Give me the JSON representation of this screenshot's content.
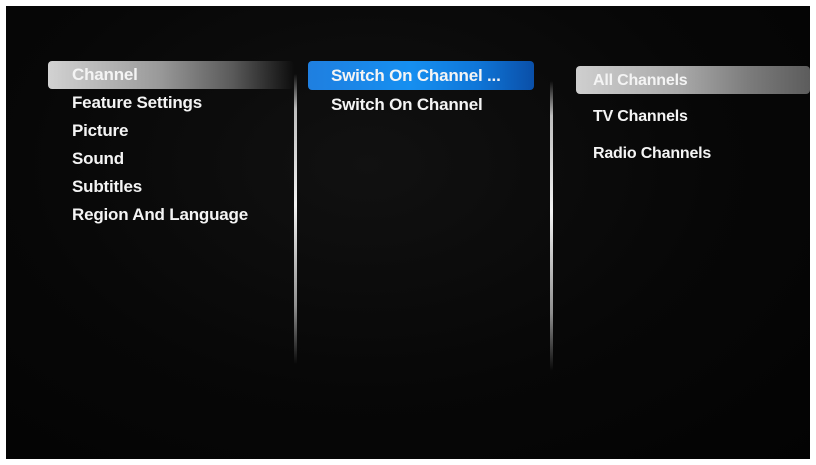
{
  "menu": {
    "level1": {
      "selected_index": 0,
      "items": [
        {
          "label": "Channel"
        },
        {
          "label": "Feature Settings"
        },
        {
          "label": "Picture"
        },
        {
          "label": "Sound"
        },
        {
          "label": "Subtitles"
        },
        {
          "label": "Region And Language"
        }
      ]
    },
    "level2": {
      "selected_index": 0,
      "items": [
        {
          "label": "Switch On Channel ..."
        },
        {
          "label": "Switch On Channel"
        }
      ]
    },
    "level3": {
      "selected_index": 0,
      "items": [
        {
          "label": "All Channels"
        },
        {
          "label": "TV Channels"
        },
        {
          "label": "Radio Channels"
        }
      ]
    }
  },
  "colors": {
    "background": "#050505",
    "text": "#f4f4f4",
    "focus_highlight": "#1a8cf0",
    "selected_highlight": "#b8b8b8"
  }
}
